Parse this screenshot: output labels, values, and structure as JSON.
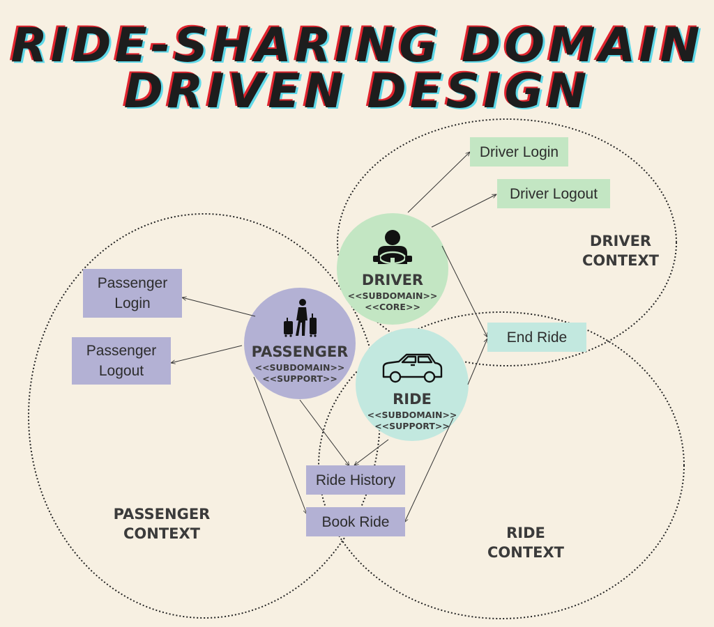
{
  "title": {
    "line1": "RIDE-SHARING DOMAIN",
    "line2": "DRIVEN DESIGN"
  },
  "contexts": {
    "driver": "DRIVER\nCONTEXT",
    "passenger": "PASSENGER\nCONTEXT",
    "ride": "RIDE\nCONTEXT"
  },
  "subdomains": {
    "driver": {
      "name": "DRIVER",
      "stereotype": "<<SUBDOMAIN>>\n<<CORE>>",
      "icon": "driver-steering-wheel-icon"
    },
    "passenger": {
      "name": "PASSENGER",
      "stereotype": "<<SUBDOMAIN>>\n<<SUPPORT>>",
      "icon": "traveler-luggage-icon"
    },
    "ride": {
      "name": "RIDE",
      "stereotype": "<<SUBDOMAIN>>\n<<SUPPORT>>",
      "icon": "car-icon"
    }
  },
  "capabilities": {
    "driver_login": "Driver Login",
    "driver_logout": "Driver Logout",
    "end_ride": "End Ride",
    "passenger_login": "Passenger Login",
    "passenger_logout": "Passenger Logout",
    "ride_history": "Ride History",
    "book_ride": "Book Ride"
  },
  "colors": {
    "background": "#f7f0e2",
    "driver": "#c3e6c3",
    "passenger": "#b3b1d4",
    "ride": "#c2e8df",
    "title_text": "#1d1d1d",
    "title_shadow_red": "#e0242e",
    "title_shadow_cyan": "#5fd8e8"
  }
}
